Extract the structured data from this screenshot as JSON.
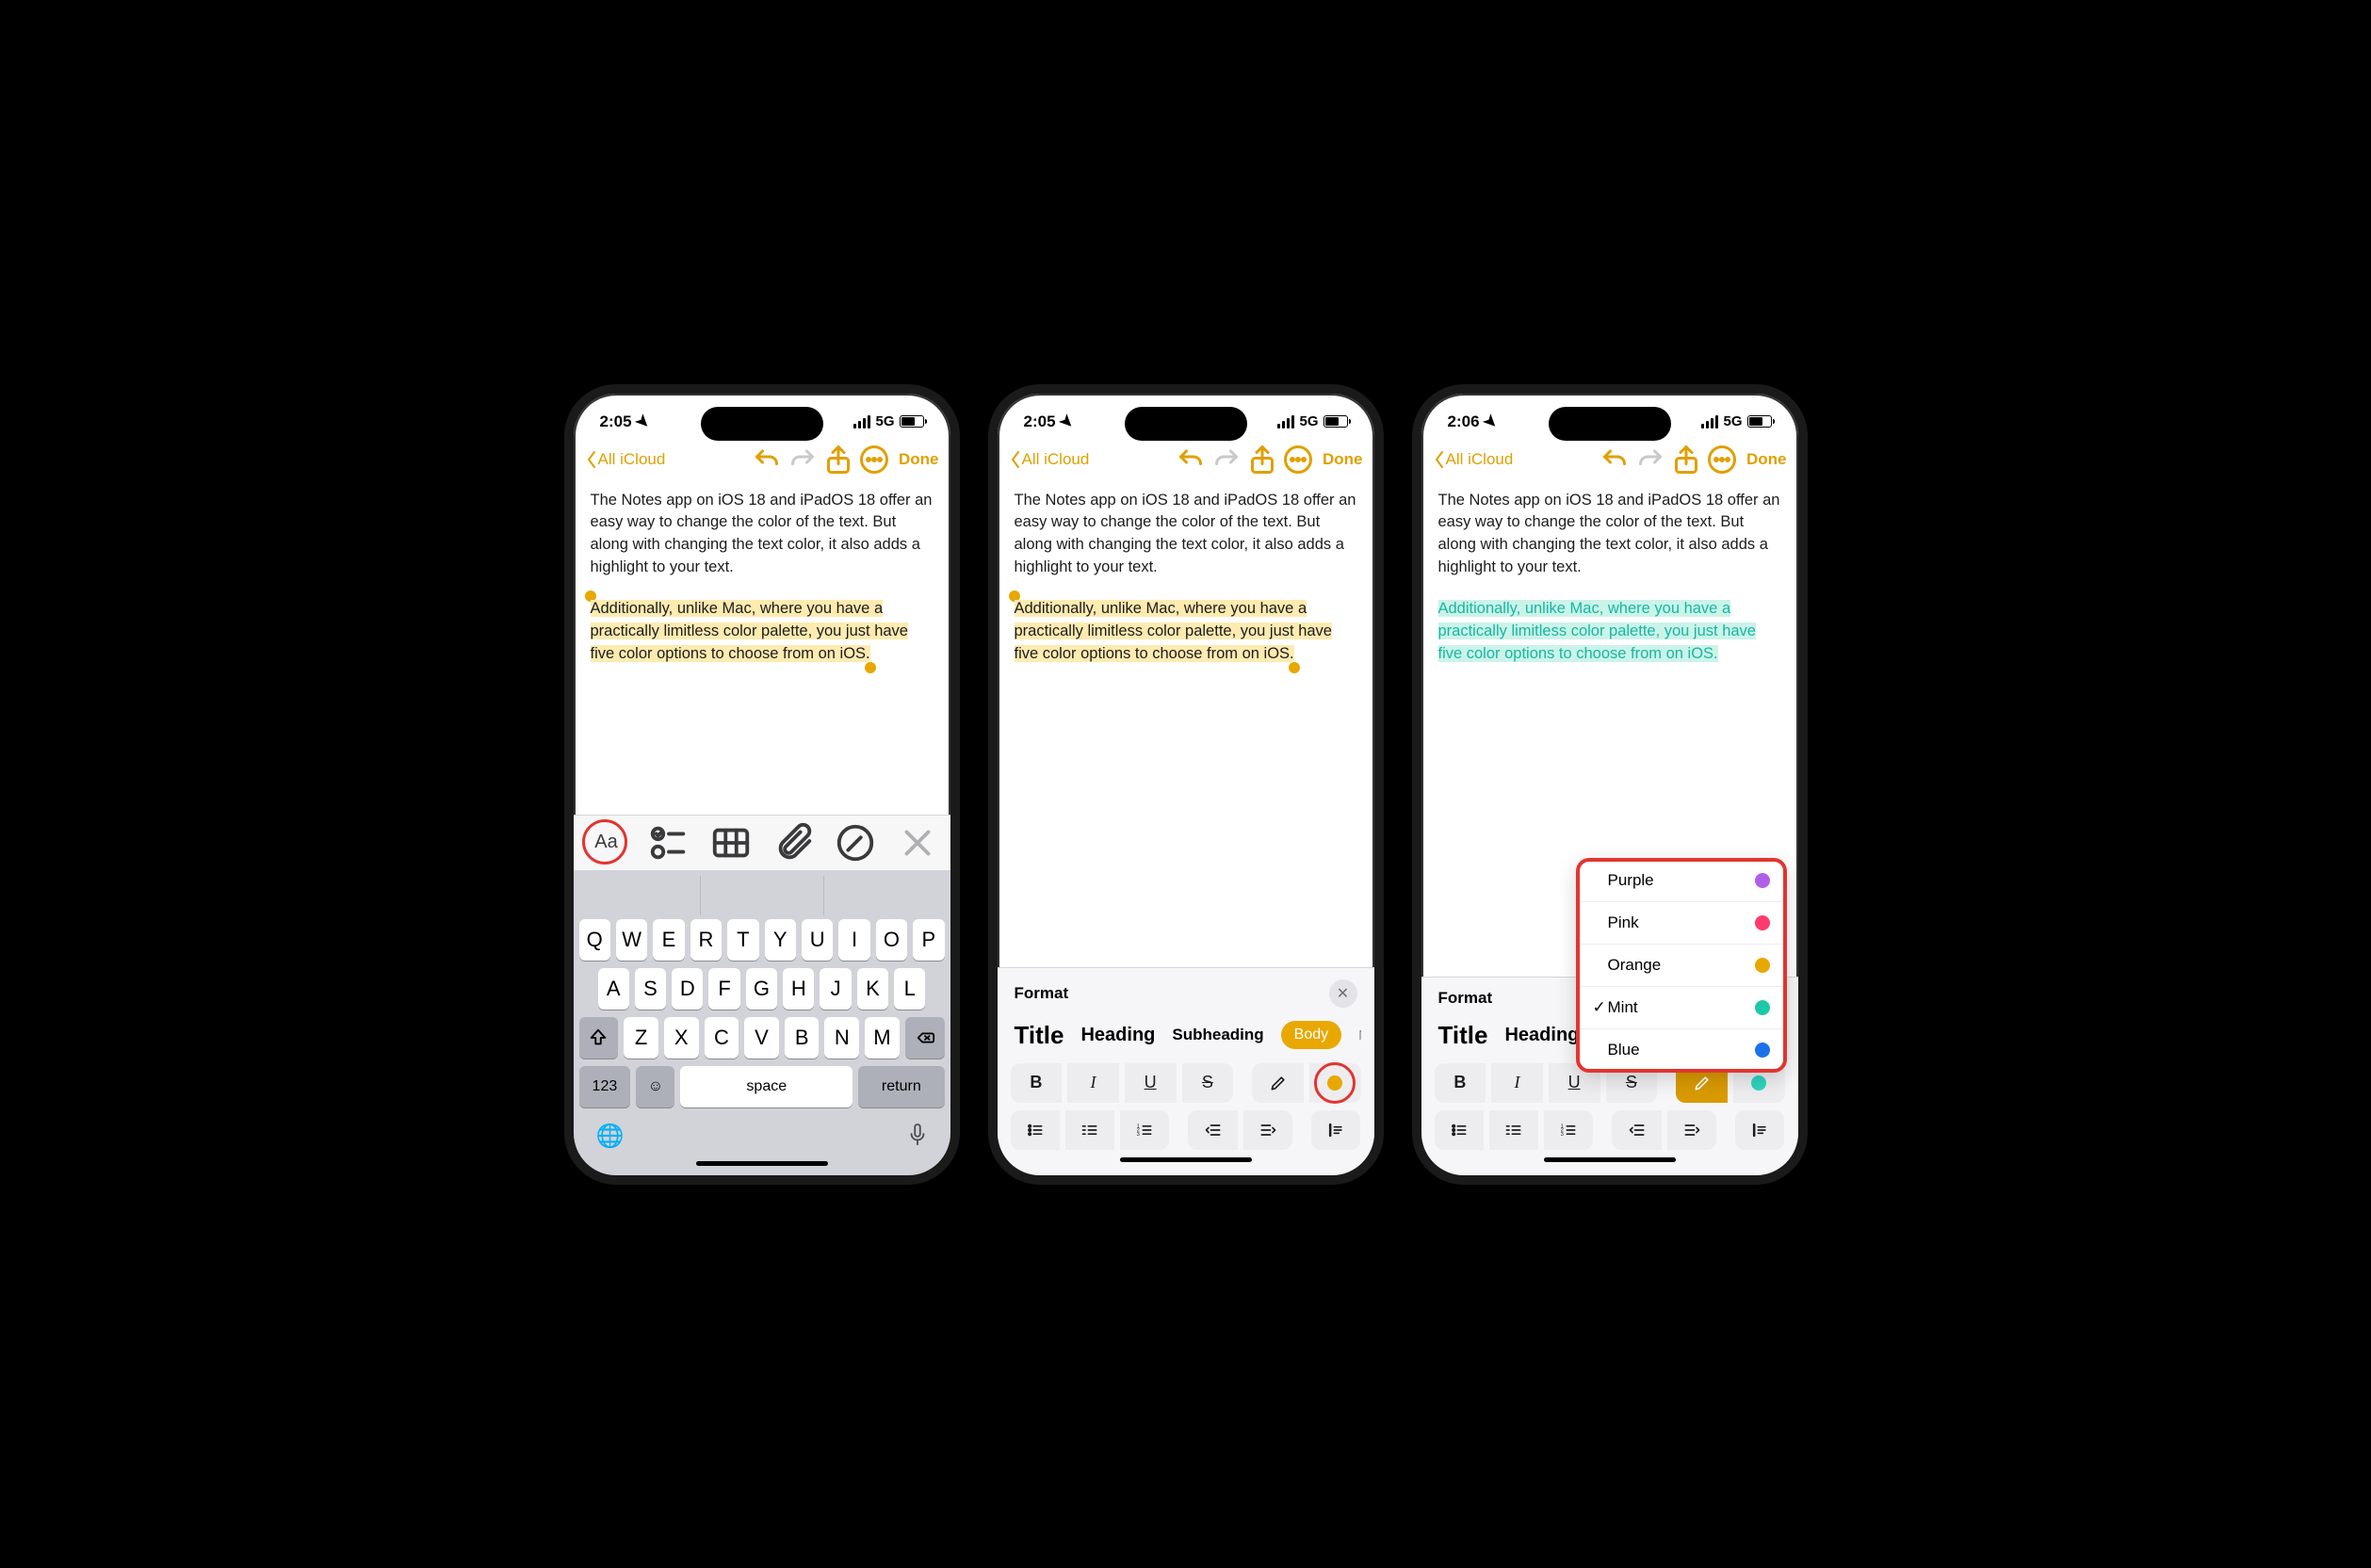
{
  "phones": {
    "p1": {
      "time": "2:05"
    },
    "p2": {
      "time": "2:05"
    },
    "p3": {
      "time": "2:06"
    }
  },
  "status": {
    "network": "5G"
  },
  "nav": {
    "back": "All iCloud",
    "done": "Done"
  },
  "note": {
    "para1": "The Notes app on iOS 18 and iPadOS 18 offer an easy way to change the color of the text. But along with changing the text color, it also adds a highlight to your text.",
    "para2": "Additionally, unlike Mac, where you have a practically limitless color palette, you just have five color options to choose from on iOS."
  },
  "keyboard": {
    "row1": [
      "Q",
      "W",
      "E",
      "R",
      "T",
      "Y",
      "U",
      "I",
      "O",
      "P"
    ],
    "row2": [
      "A",
      "S",
      "D",
      "F",
      "G",
      "H",
      "J",
      "K",
      "L"
    ],
    "row3": [
      "Z",
      "X",
      "C",
      "V",
      "B",
      "N",
      "M"
    ],
    "numkey": "123",
    "space": "space",
    "return": "return"
  },
  "format": {
    "title": "Format",
    "styles": {
      "title": "Title",
      "heading": "Heading",
      "sub": "Subheading",
      "body": "Body",
      "more": "Mo"
    },
    "inline": {
      "b": "B",
      "i": "I",
      "u": "U",
      "s": "S"
    }
  },
  "color_menu": {
    "items": [
      {
        "label": "Purple",
        "swatch": "sw-purple",
        "checked": false
      },
      {
        "label": "Pink",
        "swatch": "sw-pink",
        "checked": false
      },
      {
        "label": "Orange",
        "swatch": "sw-orange",
        "checked": false
      },
      {
        "label": "Mint",
        "swatch": "sw-mint",
        "checked": true
      },
      {
        "label": "Blue",
        "swatch": "sw-blue",
        "checked": false
      }
    ]
  }
}
